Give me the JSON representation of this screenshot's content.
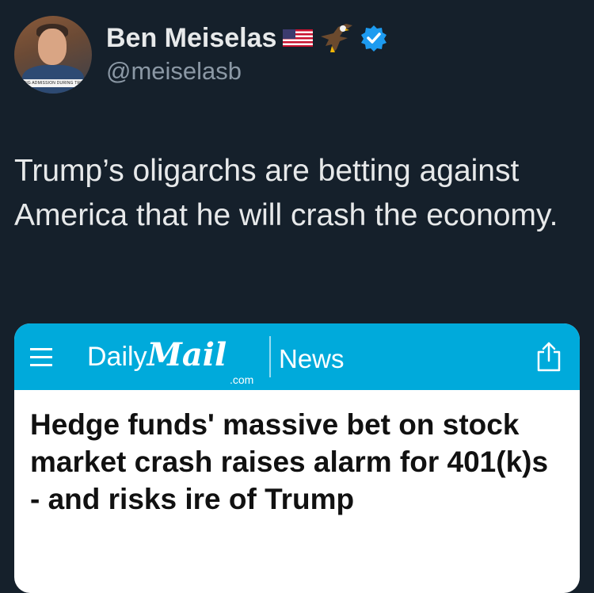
{
  "author": {
    "display_name": "Ben Meiselas",
    "handle": "@meiselasb",
    "avatar_ticker": "...ING ADMISSION DURING TRIAL",
    "badges": [
      "us-flag-icon",
      "eagle-icon",
      "verified-icon"
    ],
    "verified_color": "#1d9bf0"
  },
  "tweet": {
    "text": "Trump’s oligarchs are betting against America that he will crash the economy."
  },
  "card": {
    "brand_daily": "Daily",
    "brand_mail": "Mail",
    "brand_dotcom": ".com",
    "section": "News",
    "headline": "Hedge funds' massive bet on stock market crash raises alarm for 401(k)s - and risks ire of Trump",
    "bar_color": "#00aadb"
  },
  "colors": {
    "background": "#15202b",
    "text": "#e7e9ea",
    "secondary_text": "#8b98a5"
  }
}
